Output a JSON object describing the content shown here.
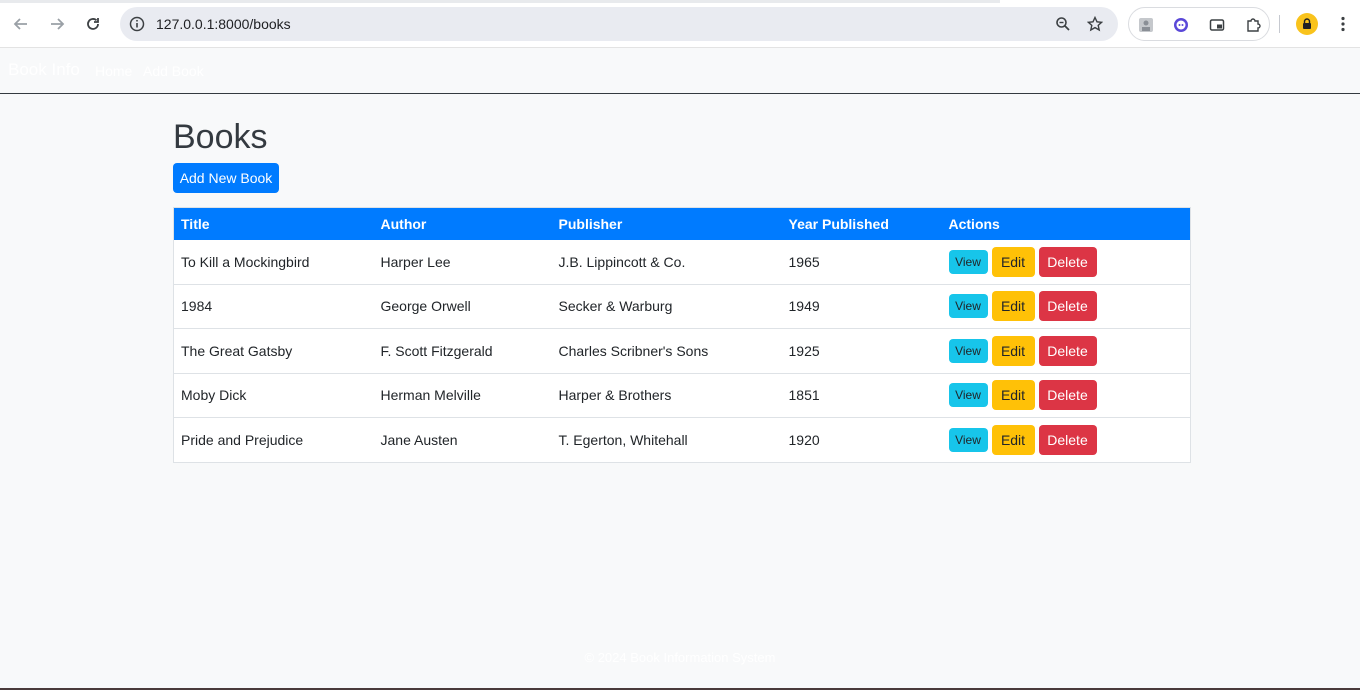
{
  "browser": {
    "url": "127.0.0.1:8000/books"
  },
  "navbar": {
    "brand": "Book Info",
    "links": [
      "Home",
      "Add Book"
    ]
  },
  "page": {
    "title": "Books",
    "add_button": "Add New Book"
  },
  "table": {
    "columns": [
      "Title",
      "Author",
      "Publisher",
      "Year Published",
      "Actions"
    ],
    "rows": [
      {
        "title": "To Kill a Mockingbird",
        "author": "Harper Lee",
        "publisher": "J.B. Lippincott & Co.",
        "year": "1965"
      },
      {
        "title": "1984",
        "author": "George Orwell",
        "publisher": "Secker & Warburg",
        "year": "1949"
      },
      {
        "title": "The Great Gatsby",
        "author": "F. Scott Fitzgerald",
        "publisher": "Charles Scribner's Sons",
        "year": "1925"
      },
      {
        "title": "Moby Dick",
        "author": "Herman Melville",
        "publisher": "Harper & Brothers",
        "year": "1851"
      },
      {
        "title": "Pride and Prejudice",
        "author": "Jane Austen",
        "publisher": "T. Egerton, Whitehall",
        "year": "1920"
      }
    ],
    "actions": {
      "view": "View",
      "edit": "Edit",
      "delete": "Delete"
    }
  },
  "footer": {
    "text": "© 2024 Book Information System"
  },
  "colors": {
    "primary": "#007bff",
    "info": "#17c5ea",
    "warning": "#ffc107",
    "danger": "#dc3545"
  }
}
